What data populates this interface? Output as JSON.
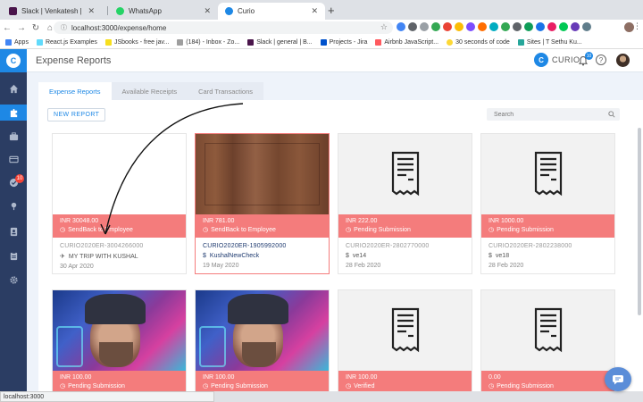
{
  "browser": {
    "tabs": [
      {
        "title": "Slack | Venkatesh | BigAppCom",
        "color": "#4a154b"
      },
      {
        "title": "WhatsApp",
        "color": "#25d366"
      },
      {
        "title": "Curio",
        "color": "#1e88e5"
      }
    ],
    "new_tab": "+",
    "url": "localhost:3000/expense/home",
    "bookmarks": [
      "Apps",
      "React.js Examples",
      "JSbooks - free jav...",
      "(184) - Inbox - Zo...",
      "Slack | general | B...",
      "Projects - Jira",
      "Airbnb JavaScript...",
      "30 seconds of code",
      "Sites | T Sethu Ku..."
    ],
    "status_url": "localhost:3000"
  },
  "app": {
    "page_title": "Expense Reports",
    "brand_name": "CURIO",
    "brand_letter": "C",
    "notification_count": "10",
    "sidebar_badge": "10",
    "tabs": [
      "Expense Reports",
      "Available Receipts",
      "Card Transactions"
    ],
    "new_report_label": "NEW REPORT",
    "search_placeholder": "Search",
    "accent_color": "#1e88e5",
    "status_color": "#f47c7c"
  },
  "cards": [
    {
      "amount": "INR 30048.00",
      "status": "SendBack to Employee",
      "report_id": "CURIO2020ER-3004266000",
      "purpose": "MY TRIP WITH KUSHAL",
      "purpose_icon": "airplane-icon",
      "date": "30 Apr 2020",
      "thumb": "blank"
    },
    {
      "amount": "INR 781.00",
      "status": "SendBack to Employee",
      "report_id": "CURIO2020ER-1905992000",
      "purpose": "KushalNewCheck",
      "purpose_icon": "dollar-icon",
      "date": "19 May 2020",
      "thumb": "wood"
    },
    {
      "amount": "INR 222.00",
      "status": "Pending Submission",
      "report_id": "CURIO2020ER-2802770000",
      "purpose": "ve14",
      "purpose_icon": "dollar-icon",
      "date": "28 Feb 2020",
      "thumb": "receipt"
    },
    {
      "amount": "INR 1000.00",
      "status": "Pending Submission",
      "report_id": "CURIO2020ER-2802238000",
      "purpose": "ve18",
      "purpose_icon": "dollar-icon",
      "date": "28 Feb 2020",
      "thumb": "receipt"
    },
    {
      "amount": "INR 100.00",
      "status": "Pending Submission",
      "thumb": "photo"
    },
    {
      "amount": "INR 100.00",
      "status": "Pending Submission",
      "thumb": "photo"
    },
    {
      "amount": "INR 100.00",
      "status": "Verified",
      "thumb": "receipt"
    },
    {
      "amount": "0.00",
      "status": "Pending Submission",
      "thumb": "receipt"
    }
  ]
}
